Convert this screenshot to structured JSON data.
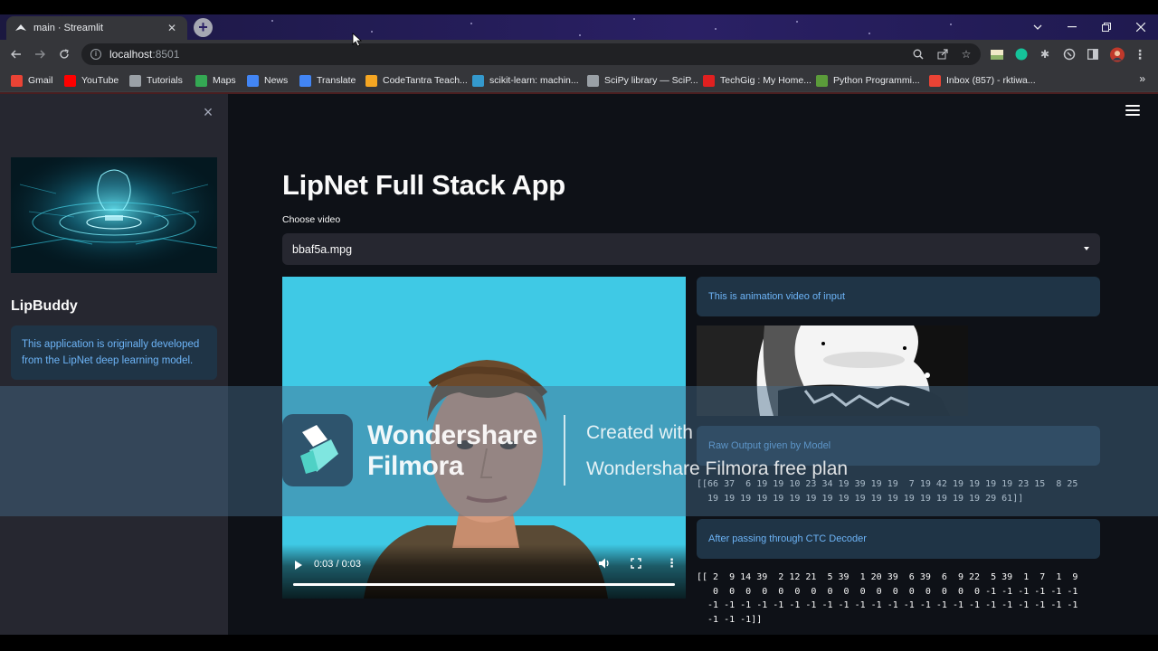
{
  "browser": {
    "tab_title": "main · Streamlit",
    "tab_close": "✕",
    "new_tab": "+",
    "url_host": "localhost",
    "url_port": ":8501",
    "bookmarks": [
      {
        "label": "Gmail",
        "icon": "gmail-icon",
        "color": "#ea4335"
      },
      {
        "label": "YouTube",
        "icon": "youtube-icon",
        "color": "#ff0000"
      },
      {
        "label": "Tutorials",
        "icon": "globe-icon",
        "color": "#9aa0a6"
      },
      {
        "label": "Maps",
        "icon": "maps-icon",
        "color": "#34a853"
      },
      {
        "label": "News",
        "icon": "news-icon",
        "color": "#4285f4"
      },
      {
        "label": "Translate",
        "icon": "translate-icon",
        "color": "#4285f4"
      },
      {
        "label": "CodeTantra Teach...",
        "icon": "codetantra-icon",
        "color": "#f5a623"
      },
      {
        "label": "scikit-learn: machin...",
        "icon": "scikit-icon",
        "color": "#3499cd"
      },
      {
        "label": "SciPy library — SciP...",
        "icon": "globe-icon",
        "color": "#9aa0a6"
      },
      {
        "label": "TechGig : My Home...",
        "icon": "techgig-icon",
        "color": "#e02020"
      },
      {
        "label": "Python Programmi...",
        "icon": "python-icon",
        "color": "#5b9b3a"
      },
      {
        "label": "Inbox (857) - rktiwa...",
        "icon": "gmail-icon",
        "color": "#ea4335"
      }
    ],
    "bookmarks_more": "»"
  },
  "sidebar": {
    "close": "×",
    "title": "LipBuddy",
    "info": "This application is originally developed from the LipNet deep learning model."
  },
  "main": {
    "title": "LipNet Full Stack App",
    "choose_label": "Choose video",
    "selected_video": "bbaf5a.mpg",
    "video_time": "0:03 / 0:03",
    "video_progress": 1.0,
    "more_options": "⋮",
    "animation_info": "This is animation video of input",
    "raw_info": "Raw Output given by Model",
    "raw_output": "[[66 37  6 19 19 10 23 34 19 39 19 19  7 19 42 19 19 19 19 23 15  8 25\n  19 19 19 19 19 19 19 19 19 19 19 19 19 19 19 19 19 29 61]]",
    "ctc_info": "After passing through CTC Decoder",
    "ctc_output": "[[ 2  9 14 39  2 12 21  5 39  1 20 39  6 39  6  9 22  5 39  1  7  1  9\n   0  0  0  0  0  0  0  0  0  0  0  0  0  0  0  0  0 -1 -1 -1 -1 -1 -1\n  -1 -1 -1 -1 -1 -1 -1 -1 -1 -1 -1 -1 -1 -1 -1 -1 -1 -1 -1 -1 -1 -1 -1\n  -1 -1 -1]]"
  },
  "watermark": {
    "brand_line1": "Wondershare",
    "brand_line2": "Filmora",
    "created_with": "Created with",
    "plan": "Wondershare Filmora free plan"
  },
  "colors": {
    "app_bg": "#0e1117",
    "sidebar_bg": "#262730",
    "info_bg": "#1f3446",
    "info_text": "#6db4f7",
    "accent": "#ff4b4b"
  }
}
